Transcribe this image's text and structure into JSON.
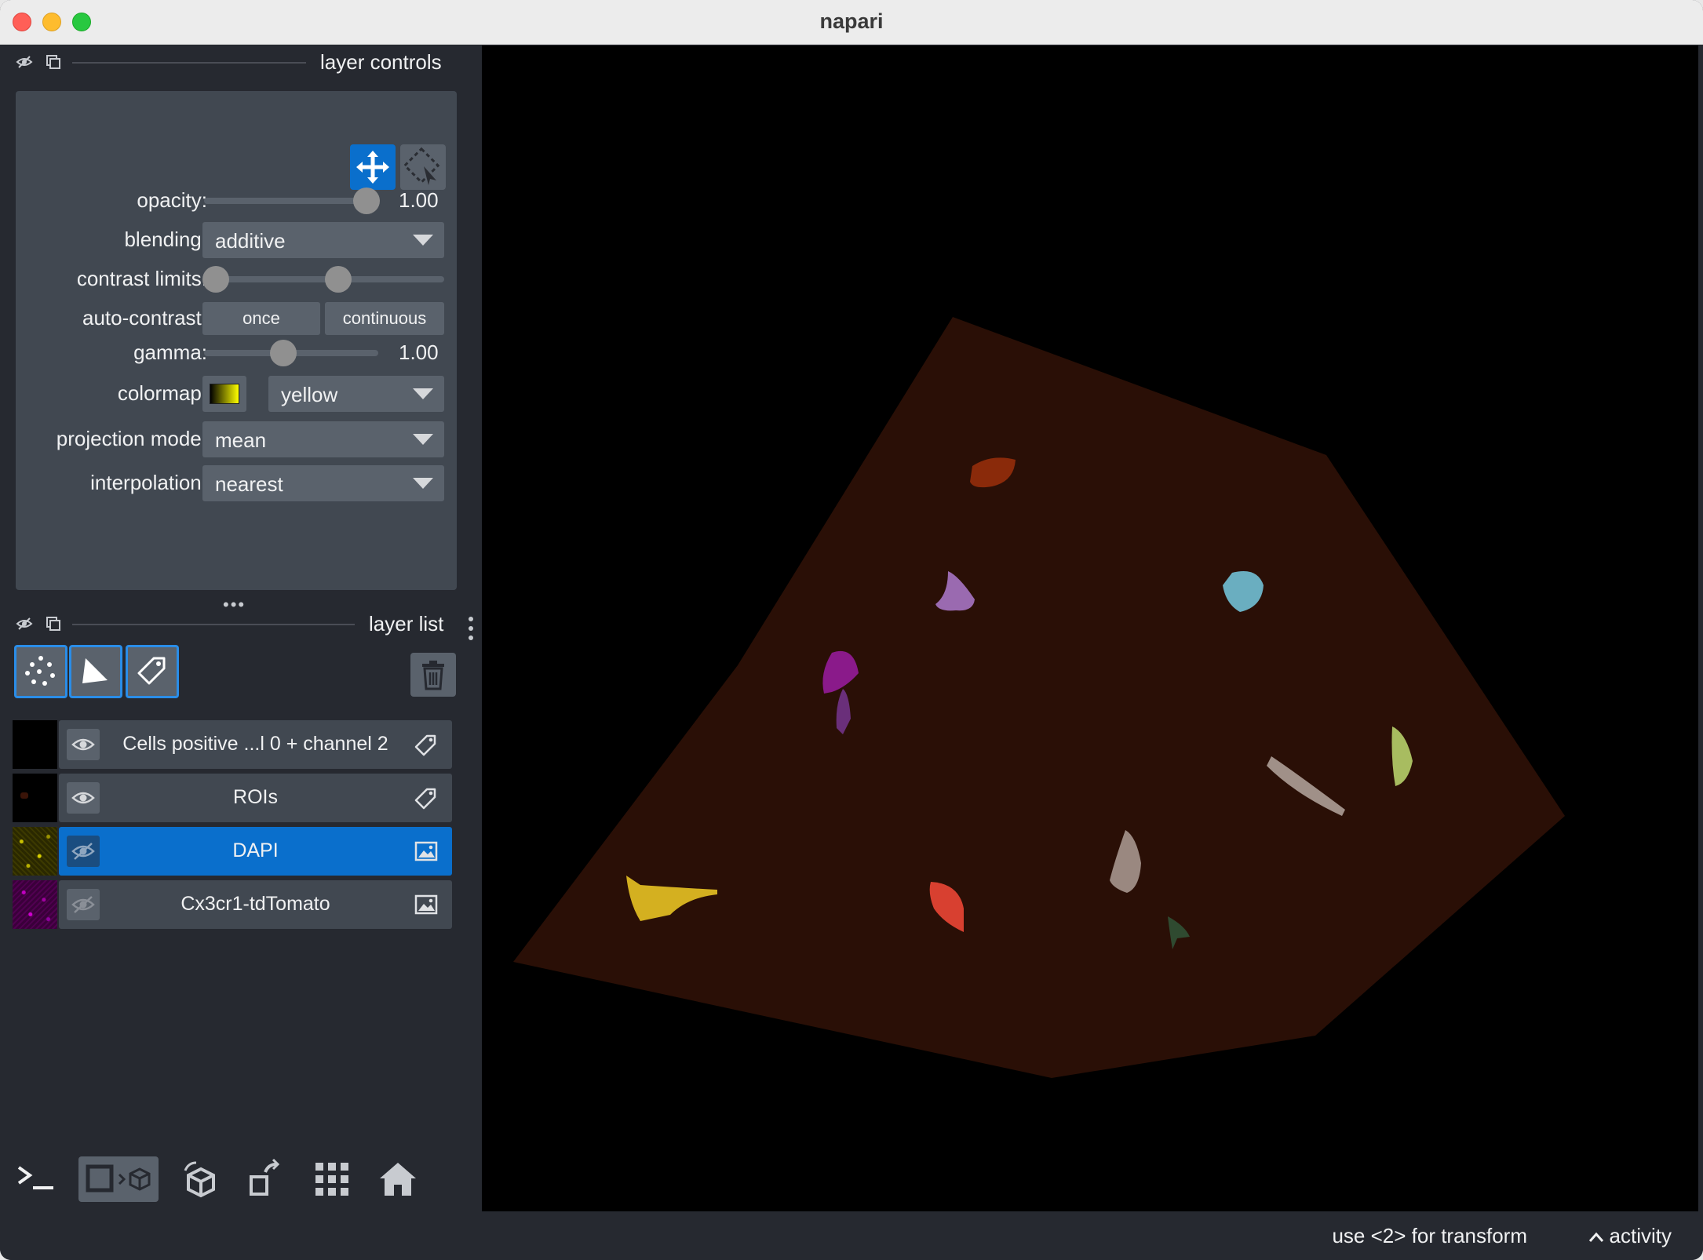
{
  "window": {
    "title": "napari"
  },
  "layer_controls": {
    "header": "layer controls",
    "opacity": {
      "label": "opacity:",
      "value": "1.00",
      "level": 1.0
    },
    "blending": {
      "label": "blending:",
      "value": "additive"
    },
    "contrast_limits": {
      "label": "contrast limits:",
      "low": 0.0,
      "high": 0.55
    },
    "auto_contrast": {
      "label": "auto-contrast:",
      "once": "once",
      "continuous": "continuous"
    },
    "gamma": {
      "label": "gamma:",
      "value": "1.00",
      "level": 0.45
    },
    "colormap": {
      "label": "colormap:",
      "value": "yellow"
    },
    "projection_mode": {
      "label": "projection mode:",
      "value": "mean"
    },
    "interpolation": {
      "label": "interpolation:",
      "value": "nearest"
    },
    "tools": [
      "move-icon",
      "select-transform-icon"
    ]
  },
  "layer_list": {
    "header": "layer list",
    "new_layer_buttons": [
      "points-icon",
      "shapes-icon",
      "labels-icon"
    ],
    "delete_icon": "trash-icon",
    "layers": [
      {
        "name": "Cells positive ...l 0 + channel 2",
        "type_icon": "label-tag-icon",
        "selected": false
      },
      {
        "name": "ROIs",
        "type_icon": "label-tag-icon",
        "selected": false
      },
      {
        "name": "DAPI",
        "type_icon": "image-icon",
        "selected": true
      },
      {
        "name": "Cx3cr1-tdTomato",
        "type_icon": "image-icon",
        "selected": false
      }
    ]
  },
  "bottom_toolbar": [
    "console-icon",
    "ndisplay-toggle-icon",
    "roll-dims-icon",
    "transpose-icon",
    "grid-icon",
    "home-icon"
  ],
  "status_bar": {
    "message": "use <2> for transform",
    "activity": "activity"
  },
  "colors": {
    "accent": "#0a6fcc",
    "panel": "#414851",
    "background": "#262930",
    "roi_fill": "#2a0f06"
  }
}
